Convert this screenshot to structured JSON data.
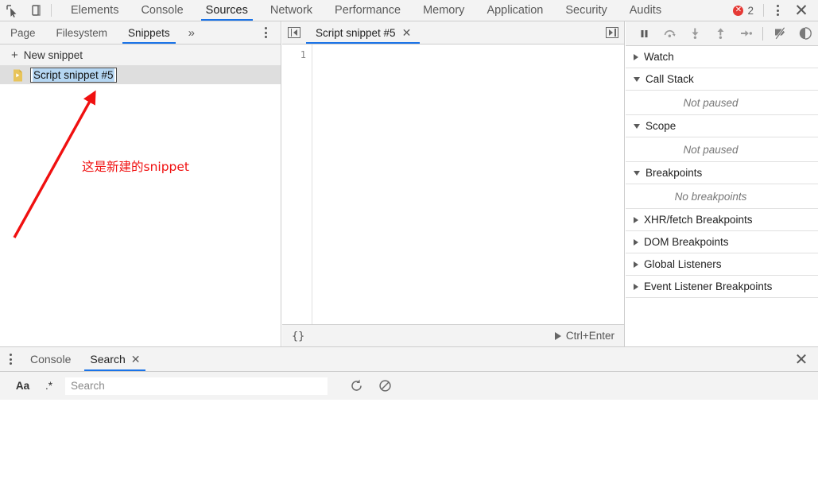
{
  "toolbar": {
    "inspect_icon": "inspect-element-icon",
    "device_icon": "device-toolbar-icon",
    "tabs": [
      {
        "label": "Elements",
        "selected": false
      },
      {
        "label": "Console",
        "selected": false
      },
      {
        "label": "Sources",
        "selected": true
      },
      {
        "label": "Network",
        "selected": false
      },
      {
        "label": "Performance",
        "selected": false
      },
      {
        "label": "Memory",
        "selected": false
      },
      {
        "label": "Application",
        "selected": false
      },
      {
        "label": "Security",
        "selected": false
      },
      {
        "label": "Audits",
        "selected": false
      }
    ],
    "error_count": "2",
    "error_glyph": "✕",
    "more_icon": "more-options-icon",
    "close_icon": "✕",
    "accent_color": "#1a73e8",
    "error_color": "#e53935"
  },
  "navigator": {
    "tabs": [
      {
        "label": "Page",
        "selected": false
      },
      {
        "label": "Filesystem",
        "selected": false
      },
      {
        "label": "Snippets",
        "selected": true
      }
    ],
    "overflow_label": "»",
    "more_icon": "more-options-icon",
    "new_snippet": {
      "plus": "+",
      "label": "New snippet"
    },
    "snippet_item": {
      "icon": "script-snippet-file-icon",
      "name": "Script snippet #5",
      "editing": true,
      "selection_color": "#b5d6f2"
    }
  },
  "annotation": {
    "text": "这是新建的snippet",
    "color": "#f01010",
    "arrow_name": "red-arrow-annotation"
  },
  "editor": {
    "collapse_left_icon": "collapse-navigator-icon",
    "collapse_right_icon": "expand-debugger-icon",
    "tab": {
      "label": "Script snippet #5",
      "close": "✕"
    },
    "line_numbers": [
      "1"
    ],
    "code_lines": [
      ""
    ],
    "footer": {
      "format_label": "{}",
      "run_label": "Ctrl+Enter"
    }
  },
  "debugger": {
    "buttons": [
      {
        "name": "resume-pause-button",
        "icon": "pause-icon"
      },
      {
        "name": "step-over-button",
        "icon": "step-over-icon"
      },
      {
        "name": "step-into-button",
        "icon": "step-into-icon"
      },
      {
        "name": "step-out-button",
        "icon": "step-out-icon"
      },
      {
        "name": "step-button",
        "icon": "step-icon"
      },
      {
        "name": "deactivate-breakpoints-button",
        "icon": "deactivate-breakpoints-icon"
      },
      {
        "name": "pause-on-exceptions-button",
        "icon": "pause-on-exceptions-icon"
      }
    ],
    "sections": [
      {
        "title": "Watch",
        "expanded": false,
        "body": null
      },
      {
        "title": "Call Stack",
        "expanded": true,
        "body": "Not paused"
      },
      {
        "title": "Scope",
        "expanded": true,
        "body": "Not paused"
      },
      {
        "title": "Breakpoints",
        "expanded": true,
        "body": "No breakpoints"
      },
      {
        "title": "XHR/fetch Breakpoints",
        "expanded": false,
        "body": null
      },
      {
        "title": "DOM Breakpoints",
        "expanded": false,
        "body": null
      },
      {
        "title": "Global Listeners",
        "expanded": false,
        "body": null
      },
      {
        "title": "Event Listener Breakpoints",
        "expanded": false,
        "body": null
      }
    ]
  },
  "drawer": {
    "more_icon": "more-options-icon",
    "tabs": [
      {
        "label": "Console",
        "selected": false,
        "closable": false
      },
      {
        "label": "Search",
        "selected": true,
        "closable": true
      }
    ],
    "tab_close": "✕",
    "close_icon": "✕",
    "search": {
      "match_case_label": "Aa",
      "regex_label": ".*",
      "placeholder": "Search",
      "value": "",
      "refresh_icon": "refresh-icon",
      "clear_icon": "clear-icon"
    }
  }
}
